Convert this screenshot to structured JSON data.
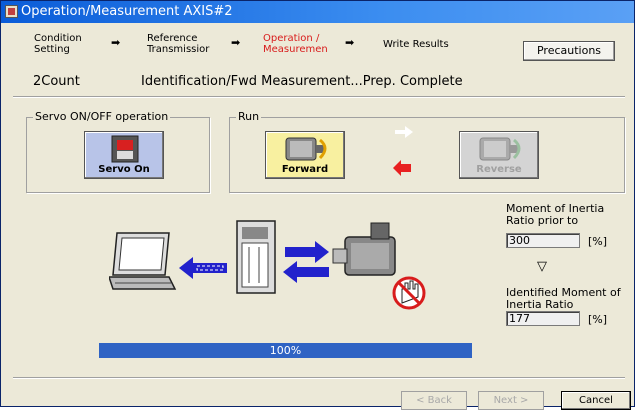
{
  "window": {
    "title": "Operation/Measurement AXIS#2"
  },
  "steps": [
    {
      "line1": "Condition",
      "line2": "Setting",
      "active": false
    },
    {
      "line1": "Reference",
      "line2": "Transmissior",
      "active": false
    },
    {
      "line1": "Operation /",
      "line2": "Measuremen",
      "active": true
    },
    {
      "line1": "Write Results",
      "line2": "",
      "active": false
    }
  ],
  "precautions_label": "Precautions",
  "status": {
    "count": "2Count",
    "message": "Identification/Fwd Measurement...Prep. Complete"
  },
  "servo_group": {
    "legend": "Servo ON/OFF operation",
    "button_label": "Servo On"
  },
  "run_group": {
    "legend": "Run",
    "forward_label": "Forward",
    "reverse_label": "Reverse"
  },
  "moment": {
    "prior_label_1": "Moment of Inertia",
    "prior_label_2": "Ratio prior to",
    "prior_value": "300",
    "unit": "[%]",
    "down_arrow": "▽",
    "identified_label_1": "Identified Moment of",
    "identified_label_2": "Inertia Ratio",
    "identified_value": "177"
  },
  "progress": {
    "text": "100%",
    "value": 1.0
  },
  "nav": {
    "back": "< Back",
    "next": "Next >",
    "cancel": "Cancel"
  },
  "colors": {
    "active_step": "#d81c1c",
    "progress": "#2f63c4",
    "arrow_red": "#e82020",
    "arrow_blue": "#2222cc"
  }
}
